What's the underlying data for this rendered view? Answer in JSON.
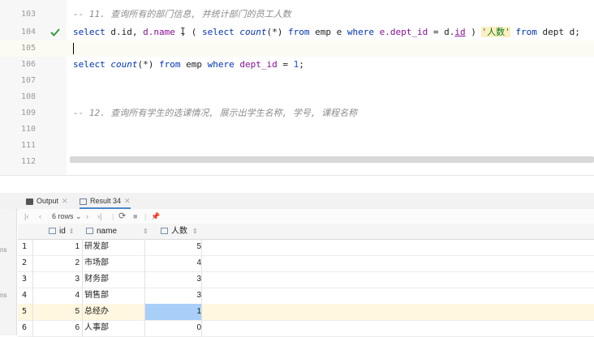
{
  "editor": {
    "lines": [
      {
        "num": "103",
        "comment": "-- 11. 查询所有的部门信息, 并统计部门的员工人数"
      },
      {
        "num": "104",
        "tokens": [
          "select",
          "d.id",
          "d.name",
          "select",
          "count",
          "(*)",
          "from",
          "emp",
          "e",
          "where",
          "e.dept_id",
          "=",
          "d.",
          "id",
          "'人数'",
          "from",
          "dept",
          "d;"
        ]
      },
      {
        "num": "105"
      },
      {
        "num": "106",
        "tokens": [
          "select",
          "count",
          "(*)",
          "from",
          "emp",
          "where",
          "dept_id",
          "=",
          "1",
          ";"
        ]
      },
      {
        "num": "107"
      },
      {
        "num": "108"
      },
      {
        "num": "109",
        "comment": "-- 12. 查询所有学生的选课情况, 展示出学生名称, 学号, 课程名称"
      },
      {
        "num": "110"
      },
      {
        "num": "111"
      },
      {
        "num": "112"
      }
    ]
  },
  "tabs": [
    {
      "label": "Output"
    },
    {
      "label": "Result 34"
    }
  ],
  "toolbar": {
    "rows_label": "6 rows"
  },
  "edge": {
    "a": "ns",
    "b": "ns"
  },
  "grid": {
    "headers": [
      "id",
      "name",
      "人数"
    ],
    "rows": [
      {
        "n": "1",
        "id": "1",
        "name": "研发部",
        "count": "5"
      },
      {
        "n": "2",
        "id": "2",
        "name": "市场部",
        "count": "4"
      },
      {
        "n": "3",
        "id": "3",
        "name": "财务部",
        "count": "3"
      },
      {
        "n": "4",
        "id": "4",
        "name": "销售部",
        "count": "3"
      },
      {
        "n": "5",
        "id": "5",
        "name": "总经办",
        "count": "1"
      },
      {
        "n": "6",
        "id": "6",
        "name": "人事部",
        "count": "0"
      }
    ]
  },
  "colors": {
    "keyword": "#0033b3",
    "comment": "#8c8c8c",
    "string": "#067d17",
    "selection": "#a9cff8",
    "check": "#3c9a3c"
  }
}
